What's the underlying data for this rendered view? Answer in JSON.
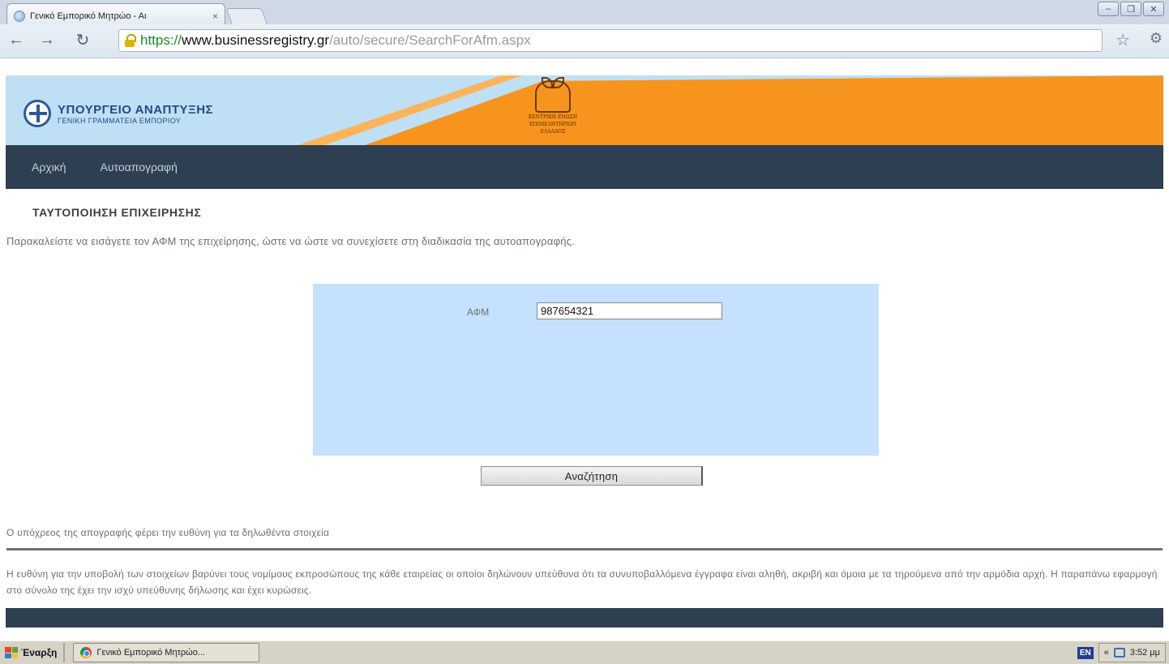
{
  "browser": {
    "tab_title": "Γενικό Εμπορικό Μητρώο - Αι",
    "tab_close": "×",
    "url_scheme": "https://",
    "url_host": "www.businessregistry.gr",
    "url_path": "/auto/secure/SearchForAfm.aspx"
  },
  "header": {
    "ministry_name": "ΥΠΟΥΡΓΕΙΟ ΑΝΑΠΤΥΞΗΣ",
    "ministry_sub": "ΓΕΝΙΚΗ ΓΡΑΜΜΑΤΕΙΑ ΕΜΠΟΡΙΟΥ",
    "kede_line1": "ΚΕΝΤΡΙΚΗ ΕΝΩΣΗ",
    "kede_line2": "ΕΠΙΜΕΛΗΤΗΡΙΩΝ",
    "kede_line3": "ΕΛΛΑΔΟΣ"
  },
  "nav": {
    "home": "Αρχική",
    "self_registration": "Αυτοαπογραφή"
  },
  "main": {
    "title": "ΤΑΥΤΟΠΟΙΗΣΗ ΕΠΙΧΕΙΡΗΣΗΣ",
    "instructions": "Παρακαλείστε να εισάγετε τον ΑΦΜ της επιχείρησης, ώστε να ώστε να συνεχίσετε στη διαδικασία της αυτοαπογραφής.",
    "afm_label": "ΑΦΜ",
    "afm_value": "987654321",
    "search_button": "Αναζήτηση",
    "disclaimer_1": "Ο υπόχρεος της απογραφής φέρει την ευθύνη για τα δηλωθέντα στοιχεία",
    "disclaimer_2": "Η ευθύνη για την υποβολή των στοιχείων βαρύνει τους νομίμους εκπροσώπους της κάθε εταιρείας οι οποίοι δηλώνουν υπεύθυνα ότι τα συνυποβαλλόμενα έγγραφα είναι αληθή, ακριβή και όμοια με τα τηρούμενα από την αρμόδια αρχή. Η παραπάνω εφαρμογή στο σύνολο της έχει την ισχύ υπεύθυνης δήλωσης και έχει κυρώσεις."
  },
  "taskbar": {
    "start": "Έναρξη",
    "task_item": "Γενικό Εμπορικό Μητρώο...",
    "lang": "EN",
    "clock": "3:52 μμ"
  }
}
